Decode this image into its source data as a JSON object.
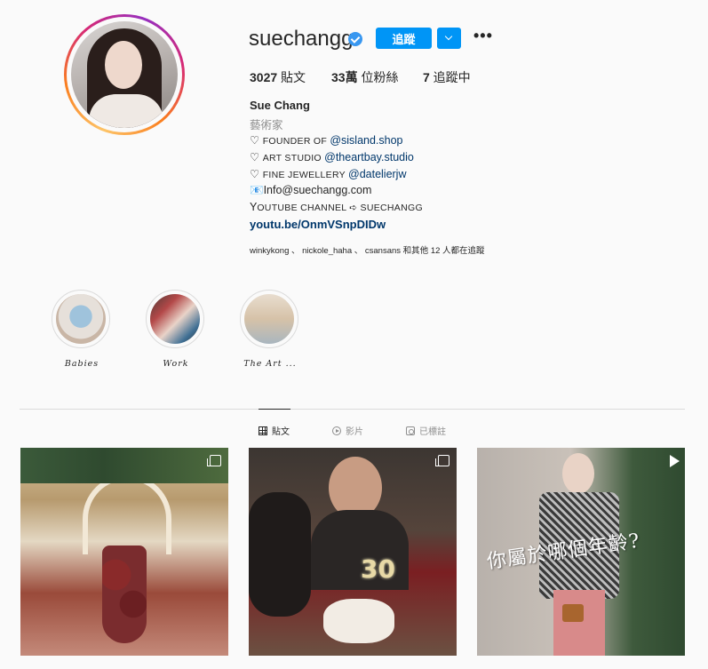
{
  "profile": {
    "username": "suechangg",
    "follow_label": "追蹤",
    "more_label": "•••",
    "stats": [
      {
        "num": "3027",
        "label": " 貼文"
      },
      {
        "num": "33萬",
        "label": " 位粉絲"
      },
      {
        "num": "7",
        "label": " 追蹤中"
      }
    ],
    "name": "Sue Chang",
    "category": "藝術家",
    "bio": [
      {
        "prefix": "♡ ",
        "caps": "FOUNDER OF ",
        "link": "@sisland.shop"
      },
      {
        "prefix": "♡ ",
        "caps": "ART STUDIO ",
        "link": "@theartbay.studio"
      },
      {
        "prefix": "♡ ",
        "caps": "FINE JEWELLERY ",
        "link": "@datelierjw"
      }
    ],
    "email_line": "📧Info@suechangg.com",
    "youtube_line": {
      "lead": "Y",
      "caps": "OUTUBE CHANNEL ➪ SUECHANGG"
    },
    "website": "youtu.be/OnmVSnpDIDw",
    "followed_by": "winkykong 、 nickole_haha 、 csansans 和其他 12 人都在追蹤"
  },
  "highlights": [
    {
      "label": "Babies"
    },
    {
      "label": "Work"
    },
    {
      "label": "The Art ..."
    }
  ],
  "tabs": [
    {
      "label": "貼文",
      "icon": "grid-icon",
      "active": true
    },
    {
      "label": "影片",
      "icon": "video-icon",
      "active": false
    },
    {
      "label": "已標註",
      "icon": "tag-icon",
      "active": false
    }
  ],
  "posts": [
    {
      "badge": "multi-photo-icon"
    },
    {
      "badge": "multi-photo-icon",
      "overlay": "30"
    },
    {
      "badge": "reel-icon",
      "overlay": "你屬於哪個年齡?"
    }
  ],
  "colors": {
    "accent": "#0095f6",
    "link": "#00376b",
    "verified": "#3897f0"
  }
}
